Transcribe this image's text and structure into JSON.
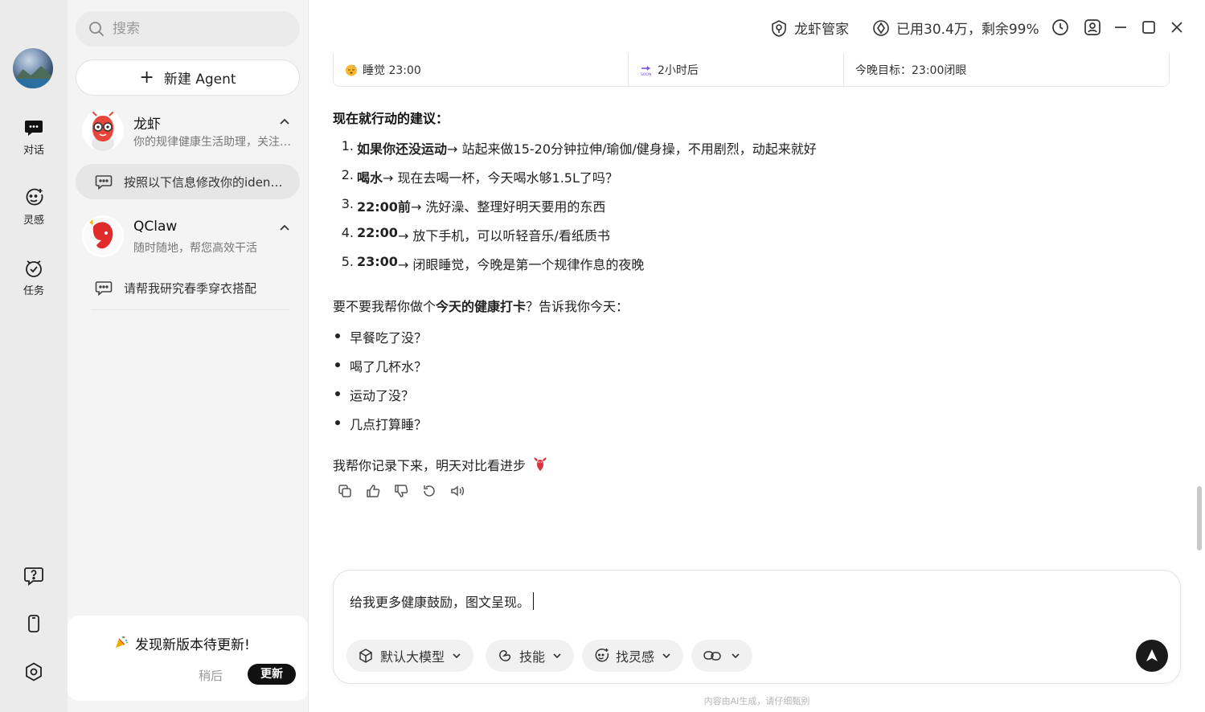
{
  "rail": {
    "items": [
      {
        "label": "对话",
        "icon": "chat-icon"
      },
      {
        "label": "灵感",
        "icon": "inspiration-icon"
      },
      {
        "label": "任务",
        "icon": "task-icon"
      }
    ],
    "bottom_icons": [
      "help-icon",
      "phone-icon",
      "settings-icon"
    ]
  },
  "sidebar": {
    "search_placeholder": "搜索",
    "new_agent_label": "新建 Agent",
    "agents": [
      {
        "name": "龙虾",
        "desc": "你的规律健康生活助理，关注作息与健康习惯",
        "conversation": "按照以下信息修改你的identity设定"
      },
      {
        "name": "QClaw",
        "desc": "随时随地，帮您高效干活",
        "conversation": "请帮我研究春季穿衣搭配"
      }
    ],
    "update": {
      "title": "发现新版本待更新!",
      "later": "稍后",
      "update": "更新"
    }
  },
  "topbar": {
    "manager": "龙虾管家",
    "usage": "已用30.4万，剩余99%"
  },
  "message": {
    "table": [
      {
        "text": "睡觉 23:00"
      },
      {
        "text": "2小时后"
      },
      {
        "text": "今晚目标：23:00闭眼"
      }
    ],
    "advice_heading": "现在就行动的建议：",
    "steps": [
      {
        "num": "1.",
        "bold": "如果你还没运动",
        "rest": " → 站起来做15-20分钟拉伸/瑜伽/健身操，不用剧烈，动起来就好"
      },
      {
        "num": "2.",
        "bold": "喝水",
        "rest": " → 现在去喝一杯，今天喝水够1.5L了吗？"
      },
      {
        "num": "3.",
        "bold": "22:00前",
        "rest": " → 洗好澡、整理好明天要用的东西"
      },
      {
        "num": "4.",
        "bold": "22:00",
        "rest": " → 放下手机，可以听轻音乐/看纸质书"
      },
      {
        "num": "5.",
        "bold": "23:00",
        "rest": " → 闭眼睡觉，今晚是第一个规律作息的夜晚"
      }
    ],
    "ask_pre": "要不要我帮你做个",
    "ask_bold": "今天的健康打卡",
    "ask_post": "？告诉我你今天：",
    "questions": [
      "早餐吃了没？",
      "喝了几杯水？",
      "运动了没？",
      "几点打算睡？"
    ],
    "record": "我帮你记录下来，明天对比看进步"
  },
  "composer": {
    "text": "给我更多健康鼓励，图文呈现。",
    "model": "默认大模型",
    "skills": "技能",
    "inspiration": "找灵感"
  },
  "disclaimer": "内容由AI生成，请仔细甄别"
}
